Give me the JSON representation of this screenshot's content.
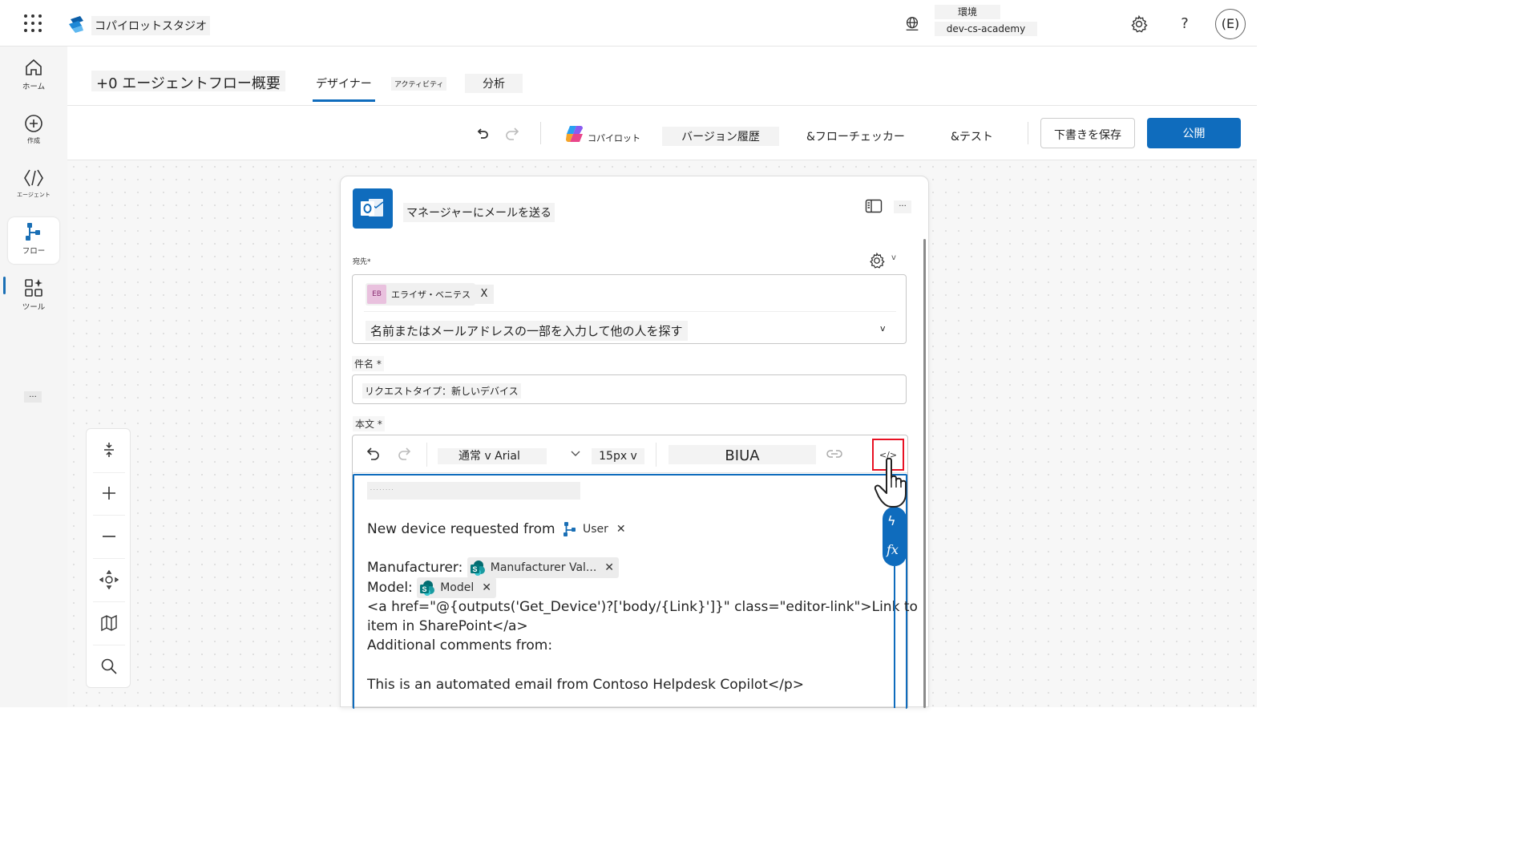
{
  "app": {
    "name": "コパイロットスタジオ"
  },
  "environment": {
    "label": "環境",
    "name": "dev-cs-academy"
  },
  "header_icons": {
    "help": "?",
    "avatar": "(E)"
  },
  "rail": {
    "items": [
      {
        "label": "ホーム",
        "icon": "home-icon"
      },
      {
        "label": "作成",
        "icon": "plus-circle-icon"
      },
      {
        "label": "エージェント",
        "icon": "agent-icon"
      },
      {
        "label": "フロー",
        "icon": "flow-icon",
        "active": true
      },
      {
        "label": "ツール",
        "icon": "tools-icon"
      }
    ],
    "more": "..."
  },
  "page": {
    "title": "+0 エージェントフロー概要",
    "tabs": [
      {
        "label": "デザイナー",
        "selected": true
      },
      {
        "label": "アクティビティ"
      },
      {
        "label": "分析"
      }
    ]
  },
  "toolbar": {
    "copilot": "コパイロット",
    "versions": "バージョン履歴",
    "checker": "&フローチェッカー",
    "test": "&テスト",
    "save": "下書きを保存",
    "publish": "公開"
  },
  "card": {
    "title": "マネージャーにメールを送る",
    "more": "...",
    "to": {
      "label": "宛先",
      "required": "*",
      "recipient": {
        "initials": "EB",
        "name": "エライザ・ベニテス",
        "remove": "X"
      },
      "placeholder": "名前またはメールアドレスの一部を入力して他の人を探す",
      "chevron": "v",
      "settings_chevron": "v"
    },
    "subject": {
      "label": "件名 *",
      "value": "リクエストタイプ：新しいデバイス"
    },
    "body": {
      "label": "本文 *",
      "font": "通常 v Arial",
      "size": "15px v",
      "formatting": "BIUA",
      "code_view": "</>",
      "format_placeholder": "· · · · · · · ·",
      "line1_prefix": "New device requested from",
      "token_user": "User",
      "manufacturer_label": "Manufacturer:",
      "token_manufacturer": "Manufacturer Val...",
      "model_label": "Model:",
      "token_model": "Model",
      "link_line1": "<a href=\"@{outputs('Get_Device')?['body/{Link}']}\" class=\"editor-link\">Link to",
      "link_line2": "item in SharePoint</a>",
      "additional": "Additional comments from:",
      "footer": "This is an automated email from Contoso Helpdesk Copilot</p>",
      "token_remove": "✕"
    },
    "dynamic": {
      "lightning": "ϟ",
      "fx": "fx"
    }
  },
  "colors": {
    "accent": "#0f6cbd",
    "highlight": "#e81123",
    "sharepoint": "#038387"
  }
}
